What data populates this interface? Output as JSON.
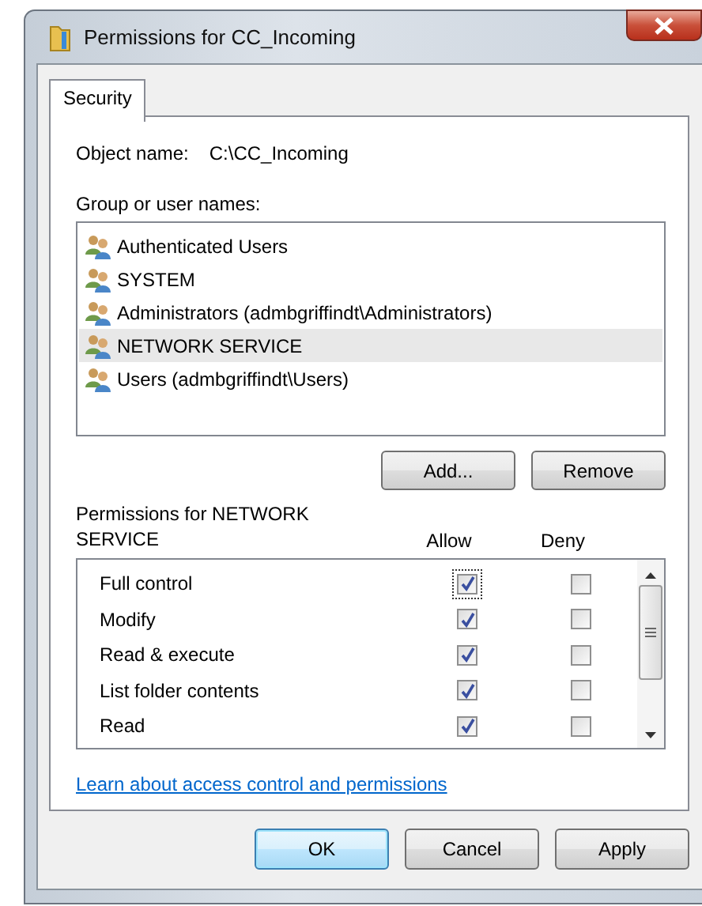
{
  "window": {
    "title": "Permissions for CC_Incoming"
  },
  "tabs": [
    {
      "label": "Security",
      "selected": true
    }
  ],
  "object_name": {
    "label": "Object name:",
    "value": "C:\\CC_Incoming"
  },
  "groups": {
    "label": "Group or user names:",
    "items": [
      {
        "name": "Authenticated Users",
        "selected": false
      },
      {
        "name": "SYSTEM",
        "selected": false
      },
      {
        "name": "Administrators (admbgriffindt\\Administrators)",
        "selected": false
      },
      {
        "name": "NETWORK SERVICE",
        "selected": true
      },
      {
        "name": "Users (admbgriffindt\\Users)",
        "selected": false
      }
    ]
  },
  "group_buttons": [
    "Add...",
    "Remove"
  ],
  "permissions": {
    "label": "Permissions for NETWORK SERVICE",
    "columns": [
      "Allow",
      "Deny"
    ],
    "rows": [
      {
        "name": "Full control",
        "allow": true,
        "deny": false,
        "focused": true
      },
      {
        "name": "Modify",
        "allow": true,
        "deny": false,
        "focused": false
      },
      {
        "name": "Read & execute",
        "allow": true,
        "deny": false,
        "focused": false
      },
      {
        "name": "List folder contents",
        "allow": true,
        "deny": false,
        "focused": false
      },
      {
        "name": "Read",
        "allow": true,
        "deny": false,
        "focused": false
      }
    ]
  },
  "link": "Learn about access control and permissions",
  "buttons": [
    {
      "label": "OK",
      "default": true
    },
    {
      "label": "Cancel",
      "default": false
    },
    {
      "label": "Apply",
      "default": false
    }
  ]
}
